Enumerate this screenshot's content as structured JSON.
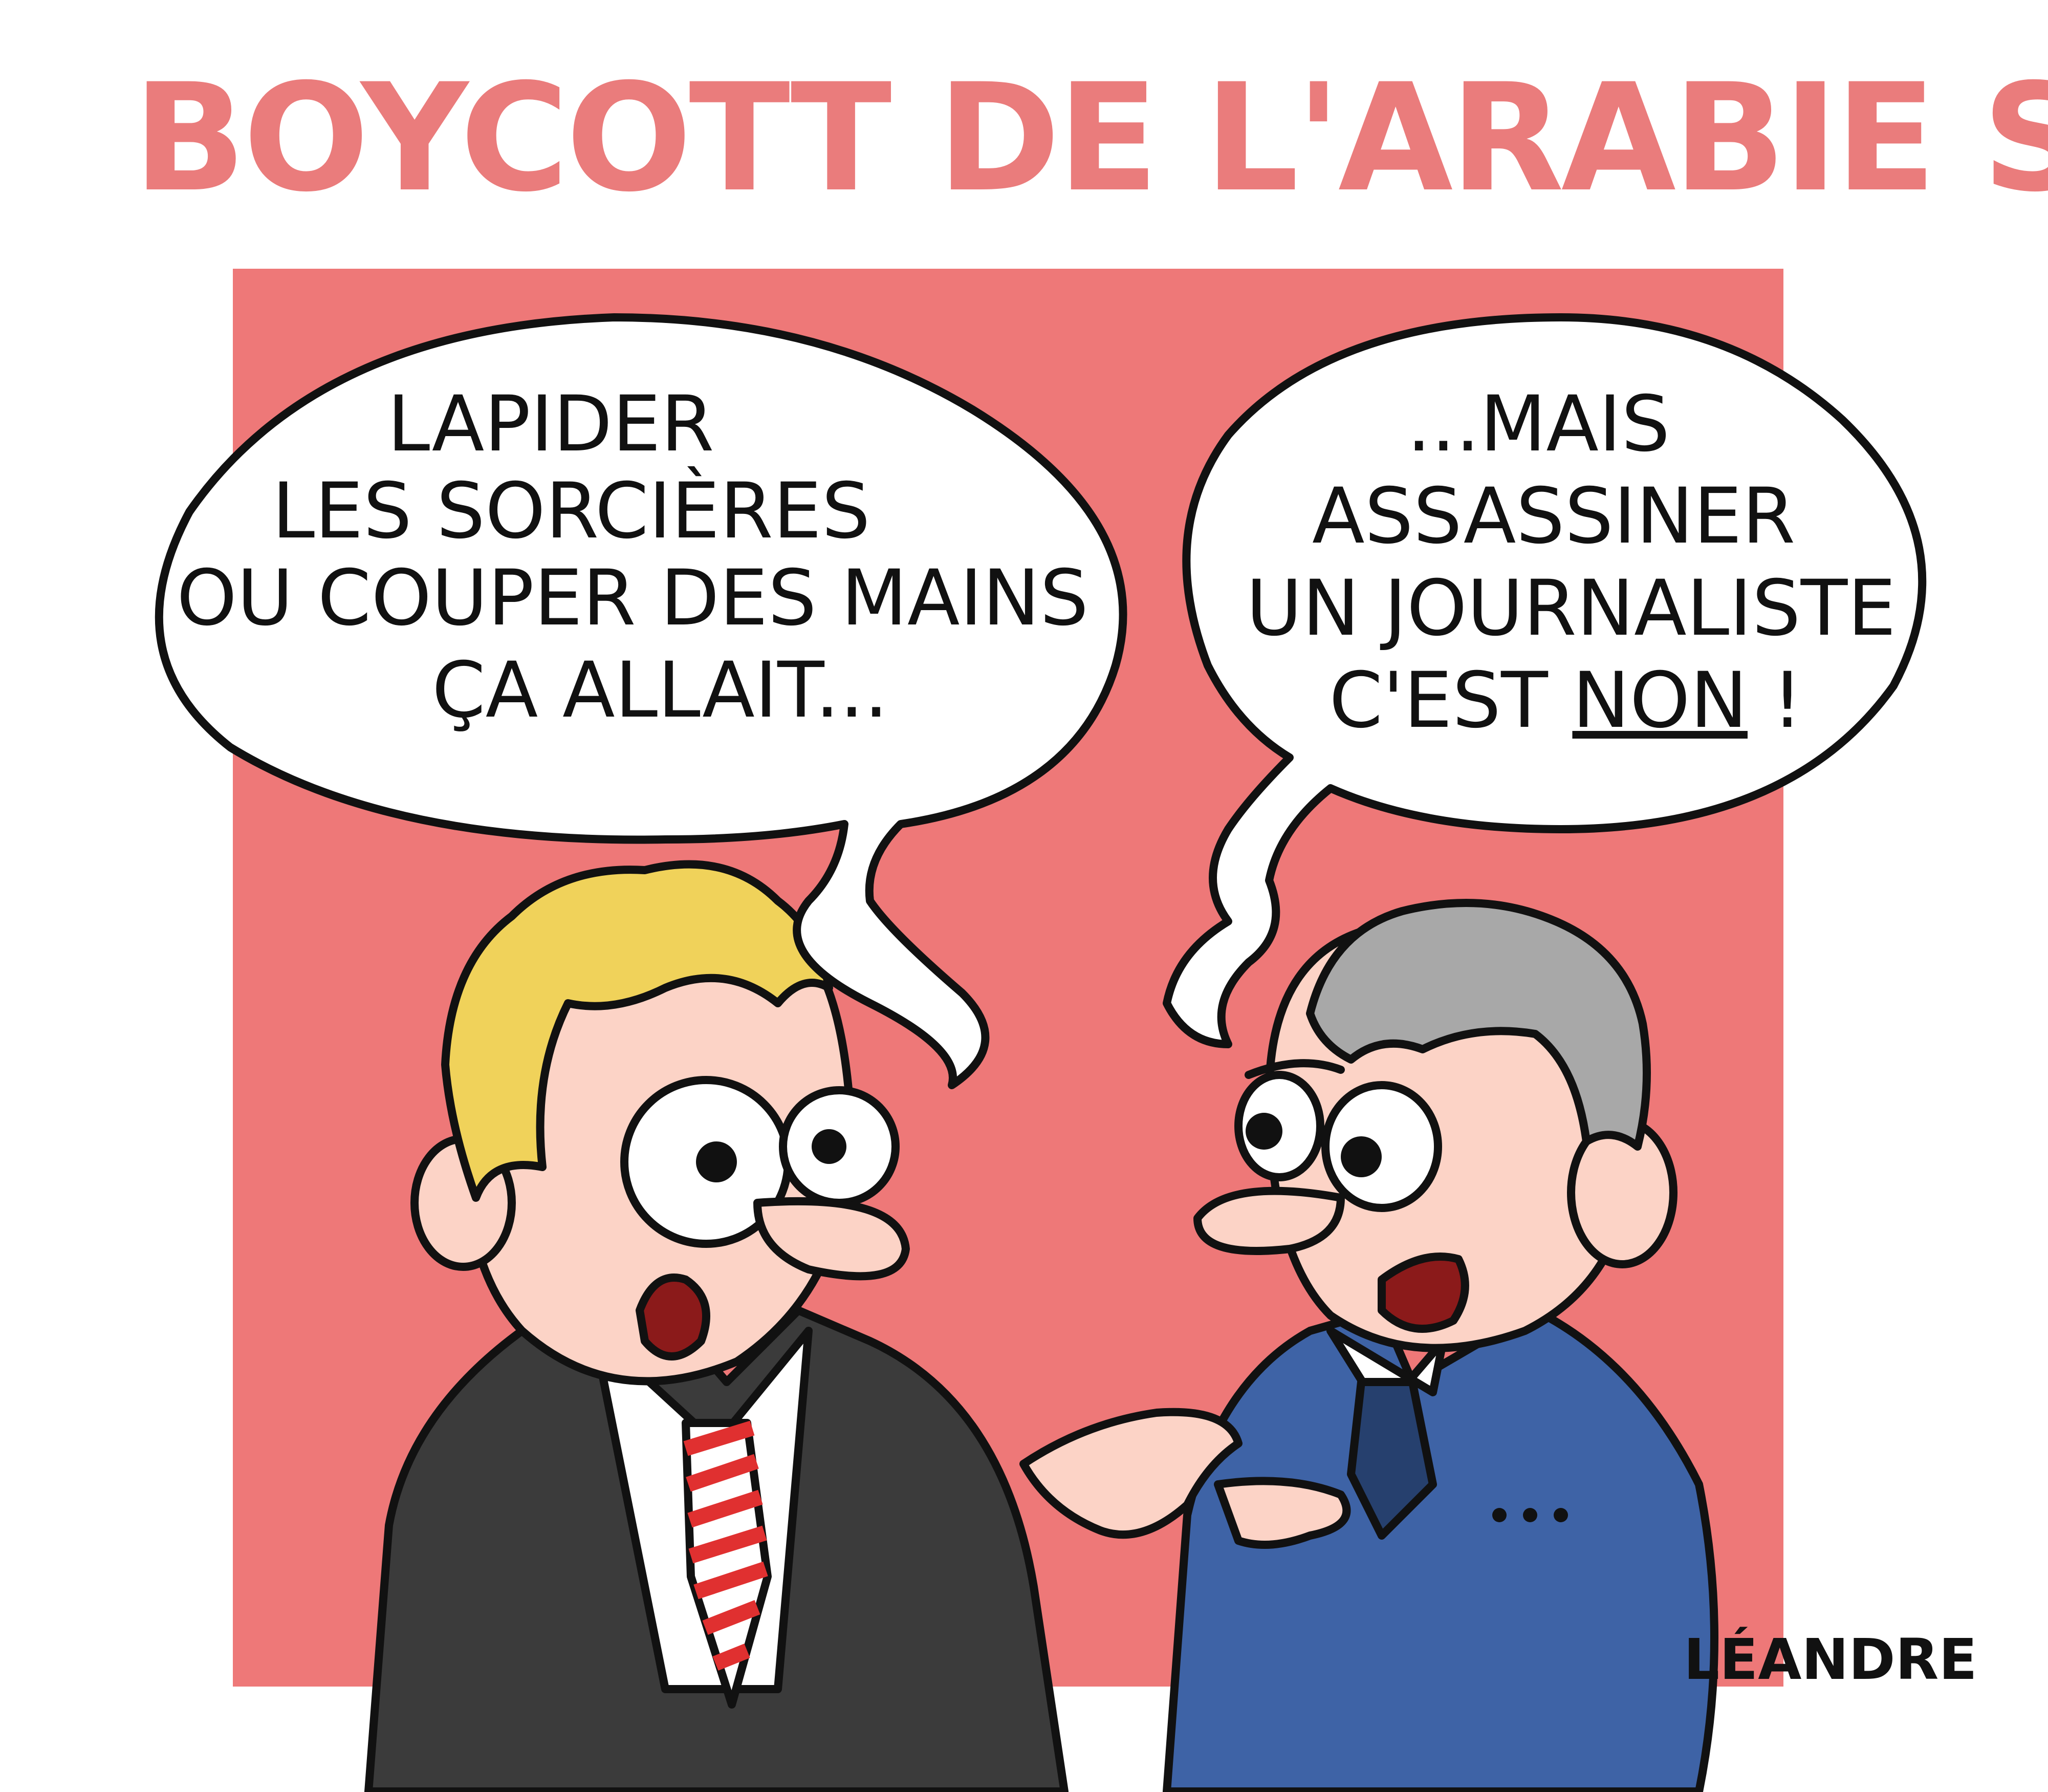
{
  "title": "BOYCOTT DE L'ARABIE SAOUDITE",
  "bubble_left": {
    "lines": [
      "LAPIDER",
      "LES SORCIÈRES",
      "OU COUPER DES MAINS",
      "ÇA ALLAIT..."
    ]
  },
  "bubble_right": {
    "lines": [
      "...MAIS",
      "ASSASSINER",
      "UN JOURNALISTE"
    ],
    "last_line_prefix": "C'EST ",
    "last_line_emphasis": "NON",
    "last_line_suffix": " !"
  },
  "signature": "LÉANDRE",
  "colors": {
    "title": "#ea7c7c",
    "panel_background": "#ee7878",
    "left_suit": "#3b3b3b",
    "right_suit": "#3e63a6",
    "blond_hair": "#f0d25a",
    "grey_hair": "#a8a8a8",
    "skin": "#fcd3c6",
    "tie_stripe": "#e03030"
  }
}
